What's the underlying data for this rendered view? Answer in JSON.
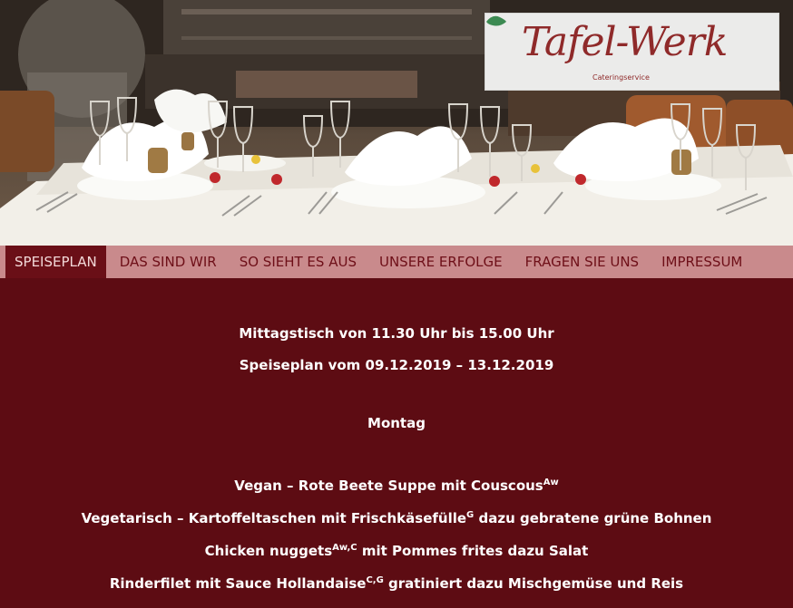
{
  "logo": {
    "wordmark": "Tafel-Werk",
    "subtitle": "Cateringservice",
    "icon": "leaf-icon"
  },
  "nav": {
    "items": [
      {
        "label": "SPEISEPLAN",
        "active": true
      },
      {
        "label": "DAS SIND WIR",
        "active": false
      },
      {
        "label": "SO SIEHT ES AUS",
        "active": false
      },
      {
        "label": "UNSERE ERFOLGE",
        "active": false
      },
      {
        "label": "FRAGEN SIE UNS",
        "active": false
      },
      {
        "label": "IMPRESSUM",
        "active": false
      }
    ]
  },
  "menu": {
    "hours": "Mittagstisch von 11.30 Uhr bis 15.00 Uhr",
    "period": "Speiseplan vom 09.12.2019 – 13.12.2019",
    "day": "Montag",
    "dishes": [
      {
        "text_before": "Vegan – Rote Beete Suppe mit Couscous",
        "sup": "Aw",
        "text_after": ""
      },
      {
        "text_before": "Vegetarisch – Kartoffeltaschen mit Frischkäsefülle",
        "sup": "G",
        "text_after": " dazu gebratene grüne Bohnen"
      },
      {
        "text_before": "Chicken nuggets",
        "sup": "Aw,C",
        "text_after": " mit Pommes frites dazu Salat"
      },
      {
        "text_before": "Rinderfilet mit Sauce Hollandaise",
        "sup": "C,G",
        "text_after": " gratiniert dazu Mischgemüse und Reis"
      }
    ]
  },
  "colors": {
    "content_bg": "#5d0c13",
    "nav_bg": "#c98a8c",
    "nav_active_bg": "#6a0f17",
    "nav_text": "#6e0f18",
    "logo_red": "#8f2a2a",
    "logo_leaf": "#3c8a52"
  }
}
